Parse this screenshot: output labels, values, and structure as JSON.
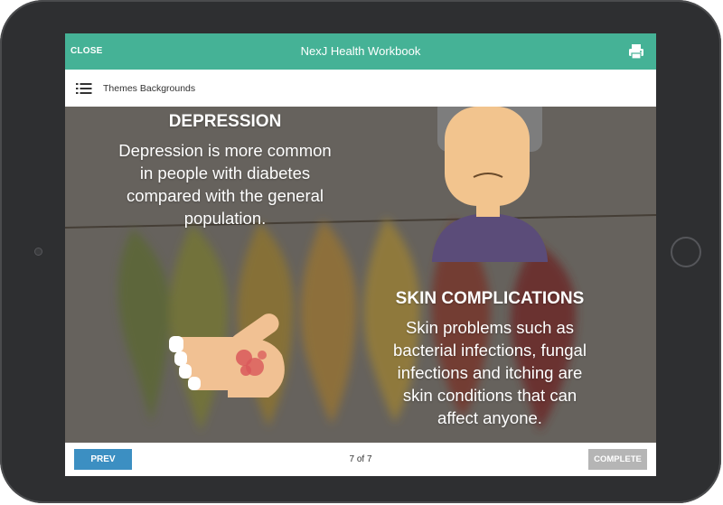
{
  "header": {
    "close_label": "CLOSE",
    "title": "NexJ Health Workbook",
    "print_icon": "printer-icon"
  },
  "subheader": {
    "menu_icon": "list-icon",
    "label": "Themes Backgrounds"
  },
  "slide": {
    "depression": {
      "heading": "DEPRESSION",
      "lines": [
        "Depression is more common",
        "in people with diabetes",
        "compared with the general",
        "population."
      ]
    },
    "skin": {
      "heading": "SKIN COMPLICATIONS",
      "lines": [
        "Skin problems such as",
        "bacterial infections, fungal",
        "infections and itching are",
        "skin conditions that can",
        "affect anyone."
      ]
    }
  },
  "footer": {
    "prev_label": "PREV",
    "page_indicator": "7 of 7",
    "complete_label": "COMPLETE"
  },
  "colors": {
    "header_bg": "#45b296",
    "prev_bg": "#3c8fc2",
    "complete_bg": "#b5b5b5",
    "tablet_frame": "#2e2f31"
  }
}
